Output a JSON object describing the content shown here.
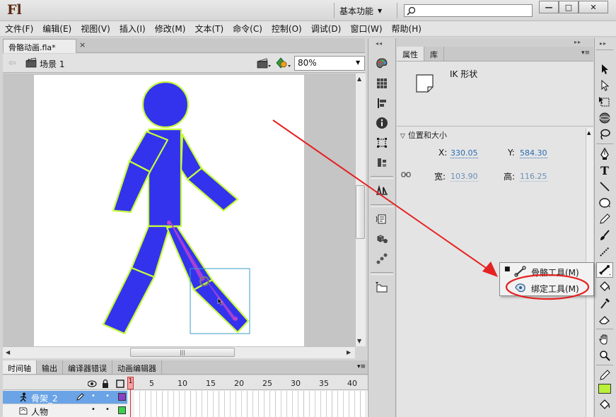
{
  "app": {
    "logo": "Fl",
    "workspace": "基本功能",
    "search_placeholder": ""
  },
  "window_controls": {
    "minimize": "—",
    "restore": "□",
    "close": "✕"
  },
  "menu": [
    "文件(F)",
    "编辑(E)",
    "视图(V)",
    "插入(I)",
    "修改(M)",
    "文本(T)",
    "命令(C)",
    "控制(O)",
    "调试(D)",
    "窗口(W)",
    "帮助(H)"
  ],
  "document": {
    "tab_title": "骨骼动画.fla*",
    "tab_close": "×",
    "scene": "场景 1",
    "zoom": "80%"
  },
  "timeline": {
    "tabs": [
      "时间轴",
      "输出",
      "编译器错误",
      "动画编辑器"
    ],
    "playhead_frame": "1",
    "frame_numbers": [
      "5",
      "10",
      "15",
      "20",
      "25",
      "30",
      "35",
      "40"
    ],
    "layers": [
      {
        "name": "骨架_2",
        "color": "#8a3fc5",
        "selected": true
      },
      {
        "name": "人物",
        "color": "#3ecf4a",
        "selected": false
      }
    ]
  },
  "properties": {
    "tabs": [
      "属性",
      "库"
    ],
    "shape_type": "IK 形状",
    "section": "位置和大小",
    "x_label": "X:",
    "x_value": "330.05",
    "y_label": "Y:",
    "y_value": "584.30",
    "w_label": "宽:",
    "w_value": "103.90",
    "h_label": "高:",
    "h_value": "116.25"
  },
  "flyout": {
    "items": [
      {
        "label": "骨骼工具(M)",
        "icon": "bone-icon",
        "current": true
      },
      {
        "label": "绑定工具(M)",
        "icon": "bind-icon",
        "current": false
      }
    ]
  },
  "colors": {
    "figure_fill": "#3333ee",
    "figure_stroke": "#c7ff3a",
    "bone": "#bb44cc",
    "annotation": "#e52222",
    "stroke_swatch": "#000000",
    "fill_swatch": "#b8f03a"
  }
}
